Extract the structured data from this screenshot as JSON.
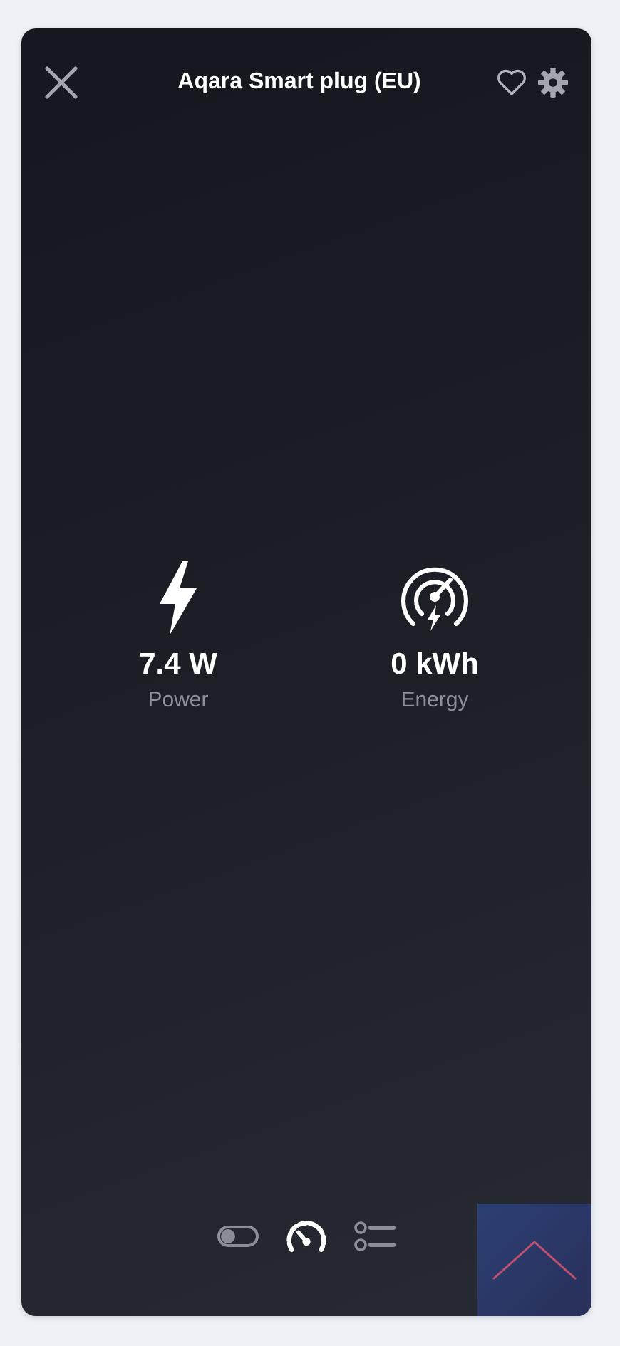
{
  "dialog": {
    "title": "Aqara Smart plug (EU)",
    "favorite": false
  },
  "stats": [
    {
      "kind": "power",
      "value": "7.4 W",
      "label": "Power"
    },
    {
      "kind": "energy",
      "value": "0 kWh",
      "label": "Energy"
    }
  ],
  "tabs": [
    {
      "kind": "toggle",
      "selected": false
    },
    {
      "kind": "gauge",
      "selected": true
    },
    {
      "kind": "list",
      "selected": false
    }
  ]
}
